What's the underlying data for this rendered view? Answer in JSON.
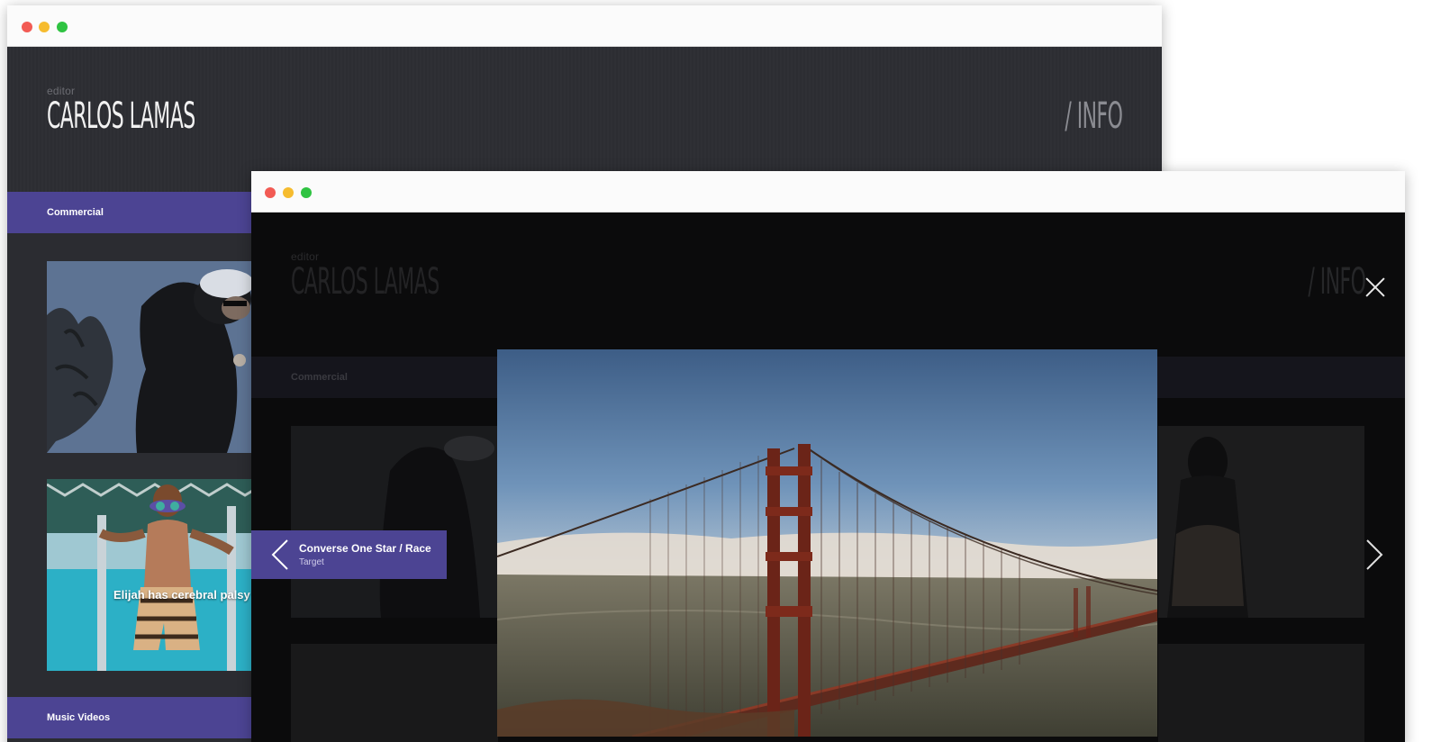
{
  "back_window": {
    "header": {
      "editor_label": "editor",
      "name": "CARLOS LAMAS",
      "info_link": "/ INFO"
    },
    "categories": {
      "first": "Commercial",
      "second": "Music Videos"
    },
    "thumbnails": [
      {
        "caption": ""
      },
      {
        "caption": "Elijah has cerebral palsy"
      }
    ]
  },
  "front_window": {
    "header": {
      "editor_label": "editor",
      "name": "CARLOS LAMAS",
      "info_link": "/ INFO"
    },
    "category": "Commercial",
    "close_icon": "close-icon",
    "previous_item": {
      "title": "Converse One Star / Race",
      "subtitle": "Target"
    },
    "lightbox": {
      "subject": "golden-gate-bridge-photo"
    }
  },
  "colors": {
    "accent": "#4c4493",
    "back_header": "#2c2d32",
    "front_overlay": "#0b0b0c",
    "chrome": "#fbfbfb",
    "dot_red": "#f25b54",
    "dot_yellow": "#f6bc2f",
    "dot_green": "#2fc342"
  }
}
